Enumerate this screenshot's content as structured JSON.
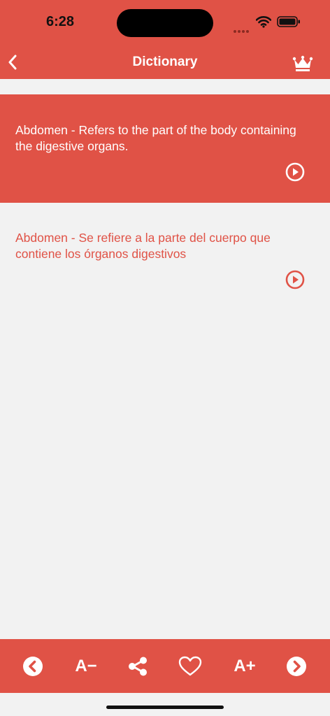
{
  "status_bar": {
    "time": "6:28"
  },
  "nav": {
    "title": "Dictionary",
    "back_icon": "chevron-left-icon",
    "premium_icon": "crown-icon"
  },
  "entries": [
    {
      "text": "Abdomen - Refers to the part of the body containing the digestive organs.",
      "language": "en",
      "play_icon": "play-circle-icon"
    },
    {
      "text": "Abdomen - Se refiere a la parte del cuerpo que contiene los órganos digestivos",
      "language": "es",
      "play_icon": "play-circle-icon"
    }
  ],
  "toolbar": {
    "previous_icon": "circle-chevron-left-icon",
    "decrease_font_label": "A−",
    "share_icon": "share-icon",
    "favorite_icon": "heart-icon",
    "increase_font_label": "A+",
    "next_icon": "circle-chevron-right-icon"
  },
  "colors": {
    "accent": "#e05246",
    "background": "#f2f2f2",
    "text_on_accent": "#ffffff"
  }
}
